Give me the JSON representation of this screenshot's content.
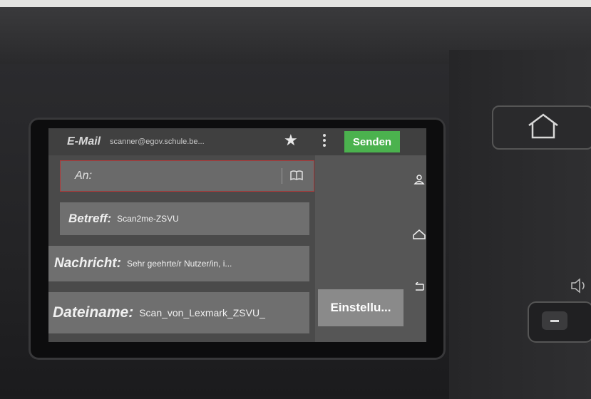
{
  "header": {
    "app_title": "E-Mail",
    "sender": "scanner@egov.schule.be...",
    "send_label": "Senden"
  },
  "fields": {
    "to_label": "An:",
    "subject_label": "Betreff:",
    "subject_value": "Scan2me-ZSVU",
    "message_label": "Nachricht:",
    "message_value": "Sehr geehrte/r Nutzer/in,  i...",
    "filename_label": "Dateiname:",
    "filename_value": "Scan_von_Lexmark_ZSVU_"
  },
  "buttons": {
    "settings_label": "Einstellu..."
  },
  "icons": {
    "favorite": "star-icon",
    "more": "more-vertical-icon",
    "address_book": "book-icon",
    "contact": "person-icon",
    "home": "home-icon",
    "back": "back-arrow-icon",
    "hardware_home": "home-icon",
    "volume": "speaker-icon"
  },
  "colors": {
    "send_button": "#4bb24e",
    "active_field_border": "#b03a3a"
  }
}
